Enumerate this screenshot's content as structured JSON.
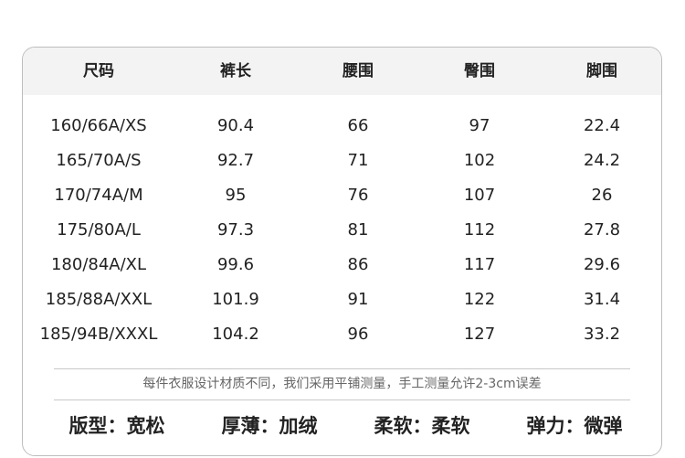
{
  "table": {
    "headers": [
      "尺码",
      "裤长",
      "腰围",
      "臀围",
      "脚围"
    ],
    "rows": [
      [
        "160/66A/XS",
        "90.4",
        "66",
        "97",
        "22.4"
      ],
      [
        "165/70A/S",
        "92.7",
        "71",
        "102",
        "24.2"
      ],
      [
        "170/74A/M",
        "95",
        "76",
        "107",
        "26"
      ],
      [
        "175/80A/L",
        "97.3",
        "81",
        "112",
        "27.8"
      ],
      [
        "180/84A/XL",
        "99.6",
        "86",
        "117",
        "29.6"
      ],
      [
        "185/88A/XXL",
        "101.9",
        "91",
        "122",
        "31.4"
      ],
      [
        "185/94B/XXXL",
        "104.2",
        "96",
        "127",
        "33.2"
      ]
    ]
  },
  "note": "每件衣服设计材质不同，我们采用平铺测量，手工测量允许2-3cm误差",
  "attributes": [
    "版型：宽松",
    "厚薄：加绒",
    "柔软：柔软",
    "弹力：微弹"
  ]
}
